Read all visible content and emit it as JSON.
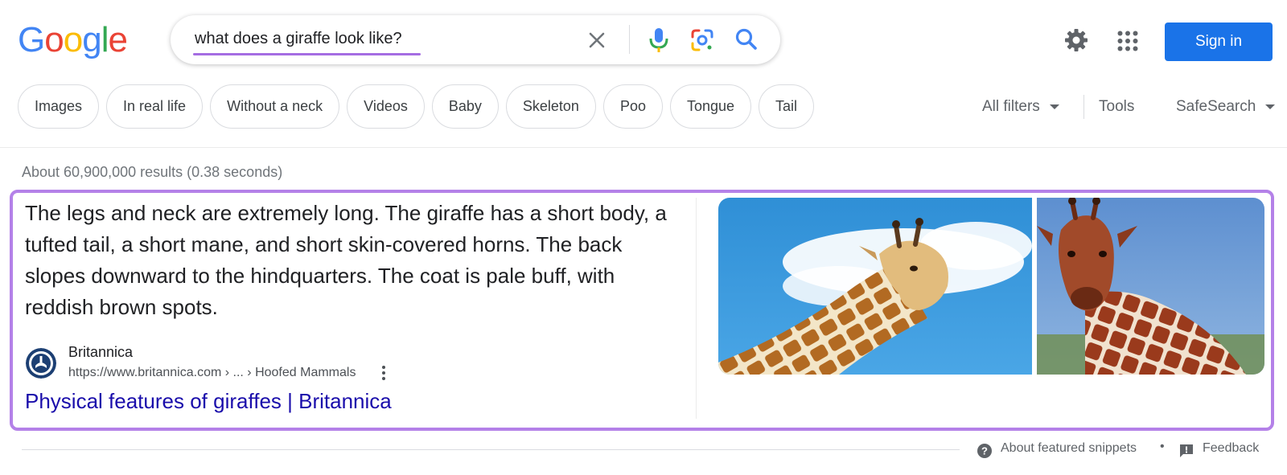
{
  "header": {
    "logo_letters": [
      "G",
      "o",
      "o",
      "g",
      "l",
      "e"
    ],
    "logo_colors": [
      "#4285f4",
      "#ea4335",
      "#fbbc05",
      "#4285f4",
      "#34a853",
      "#ea4335"
    ],
    "search_value": "what does a giraffe look like?",
    "sign_in_label": "Sign in",
    "icons": [
      "close-icon",
      "mic-icon",
      "lens-icon",
      "search-icon",
      "gear-icon",
      "apps-icon"
    ]
  },
  "chips": [
    "Images",
    "In real life",
    "Without a neck",
    "Videos",
    "Baby",
    "Skeleton",
    "Poo",
    "Tongue",
    "Tail"
  ],
  "filters": {
    "all_filters": "All filters",
    "tools": "Tools",
    "safesearch": "SafeSearch"
  },
  "results": {
    "stats": "About 60,900,000 results (0.38 seconds)"
  },
  "snippet": {
    "text": "The legs and neck are extremely long. The giraffe has a short body, a tufted tail, a short mane, and short skin-covered horns. The back slopes downward to the hindquarters. The coat is pale buff, with reddish brown spots.",
    "source_name": "Britannica",
    "source_url": "https://www.britannica.com › ... › Hoofed Mammals",
    "link_title": "Physical features of giraffes | Britannica",
    "highlight_color": "#b481e8"
  },
  "footer": {
    "about": "About featured snippets",
    "separator": "•",
    "feedback": "Feedback"
  },
  "colors": {
    "accent": "#1a73e8",
    "link": "#1a0dab",
    "search_underline": "#a56de2"
  }
}
